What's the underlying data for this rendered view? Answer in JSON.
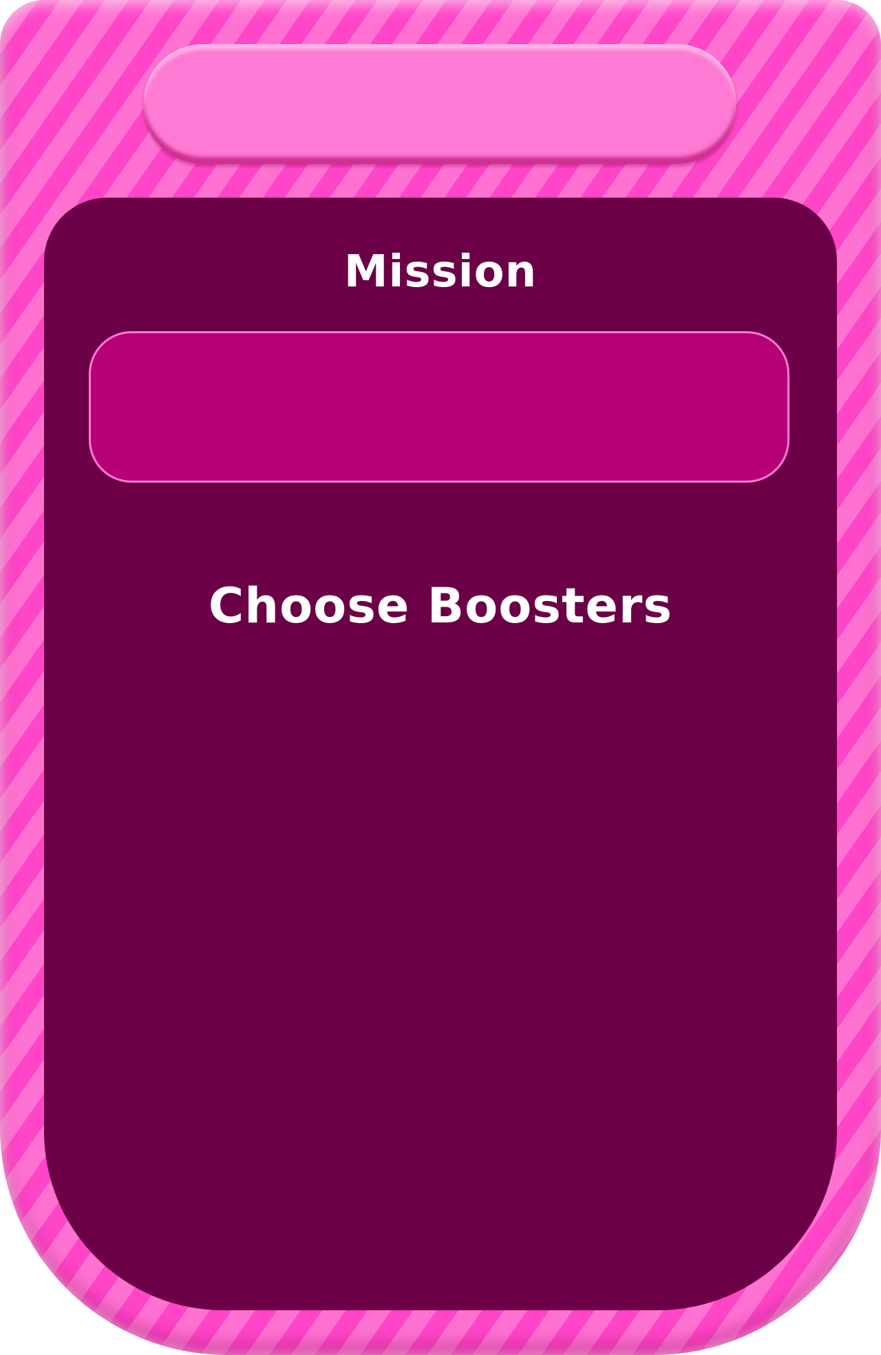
{
  "colors": {
    "stripe_dark": "#ff45c8",
    "stripe_light": "#ff72d2",
    "panel": "#6b0046",
    "mission_box": "#b70077",
    "pill": "#ff7ad4",
    "text": "#ffffff"
  },
  "panel": {
    "mission_title": "Mission",
    "boosters_title": "Choose Boosters"
  }
}
